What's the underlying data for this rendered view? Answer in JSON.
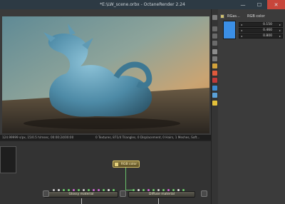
{
  "window": {
    "title": "*E:\\LW_scene.orbx - OctaneRender 2.24",
    "min_glyph": "—",
    "max_glyph": "☐",
    "close_glyph": "✕"
  },
  "viewport": {
    "status_left": "124.99999 s/px, 15/0.5 h/msec, 00:00:24/00:00",
    "status_right": "0 Textures, 871/4 Triangles, 0 Displacement, 0 Hairs, 1 Meshes, Soft..."
  },
  "inspector": {
    "node_name": "RGas...",
    "node_type": "RGB color",
    "swatch_color": "#3b8fe6",
    "params": [
      {
        "value": "0.150"
      },
      {
        "value": "0.460"
      },
      {
        "value": "0.800"
      }
    ]
  },
  "nodes": {
    "rgb_color": "RGB color",
    "glossy": "Glossy material",
    "diffuse": "Diffuse material"
  },
  "colors": {
    "accent_green": "#69c06a",
    "close_red": "#c7463b"
  }
}
